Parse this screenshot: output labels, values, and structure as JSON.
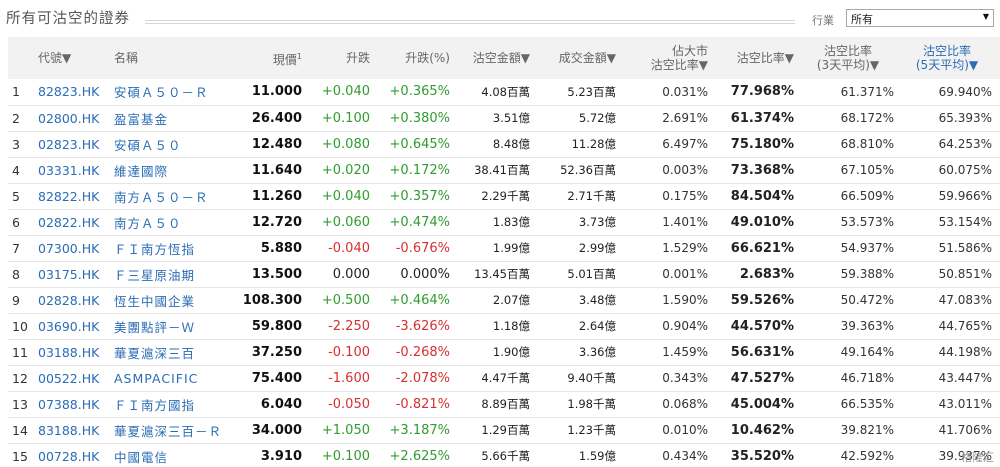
{
  "page": {
    "title": "所有可沽空的證券",
    "filter_label": "行業",
    "filter_value": "所有",
    "watermark": "格隆汇"
  },
  "table": {
    "headers": {
      "code": "代號▼",
      "name": "名稱",
      "price": "現價",
      "price_note": "1",
      "change": "升跌",
      "change_pct": "升跌(%)",
      "short_amount": "沽空金額▼",
      "turnover": "成交金額▼",
      "market_ratio_line1": "佔大市",
      "market_ratio_line2": "沽空比率▼",
      "short_ratio": "沽空比率▼",
      "avg3_line1": "沽空比率",
      "avg3_line2": "(3天平均)▼",
      "avg5_line1": "沽空比率",
      "avg5_line2": "(5天平均)▼"
    },
    "rows": [
      {
        "idx": "1",
        "code": "82823.HK",
        "name": "安碩Ａ５０－Ｒ",
        "price": "11.000",
        "change": "+0.040",
        "change_pct": "+0.365%",
        "dir": "up",
        "short_amount": "4.08百萬",
        "turnover": "5.23百萬",
        "market_ratio": "0.031%",
        "short_ratio": "77.968%",
        "avg3": "61.371%",
        "avg5": "69.940%"
      },
      {
        "idx": "2",
        "code": "02800.HK",
        "name": "盈富基金",
        "price": "26.400",
        "change": "+0.100",
        "change_pct": "+0.380%",
        "dir": "up",
        "short_amount": "3.51億",
        "turnover": "5.72億",
        "market_ratio": "2.691%",
        "short_ratio": "61.374%",
        "avg3": "68.172%",
        "avg5": "65.393%"
      },
      {
        "idx": "3",
        "code": "02823.HK",
        "name": "安碩Ａ５０",
        "price": "12.480",
        "change": "+0.080",
        "change_pct": "+0.645%",
        "dir": "up",
        "short_amount": "8.48億",
        "turnover": "11.28億",
        "market_ratio": "6.497%",
        "short_ratio": "75.180%",
        "avg3": "68.810%",
        "avg5": "64.253%"
      },
      {
        "idx": "4",
        "code": "03331.HK",
        "name": "維達國際",
        "price": "11.640",
        "change": "+0.020",
        "change_pct": "+0.172%",
        "dir": "up",
        "short_amount": "38.41百萬",
        "turnover": "52.36百萬",
        "market_ratio": "0.003%",
        "short_ratio": "73.368%",
        "avg3": "67.105%",
        "avg5": "60.075%"
      },
      {
        "idx": "5",
        "code": "82822.HK",
        "name": "南方Ａ５０－Ｒ",
        "price": "11.260",
        "change": "+0.040",
        "change_pct": "+0.357%",
        "dir": "up",
        "short_amount": "2.29千萬",
        "turnover": "2.71千萬",
        "market_ratio": "0.175%",
        "short_ratio": "84.504%",
        "avg3": "66.509%",
        "avg5": "59.966%"
      },
      {
        "idx": "6",
        "code": "02822.HK",
        "name": "南方Ａ５０",
        "price": "12.720",
        "change": "+0.060",
        "change_pct": "+0.474%",
        "dir": "up",
        "short_amount": "1.83億",
        "turnover": "3.73億",
        "market_ratio": "1.401%",
        "short_ratio": "49.010%",
        "avg3": "53.573%",
        "avg5": "53.154%"
      },
      {
        "idx": "7",
        "code": "07300.HK",
        "name": "ＦＩ南方恆指",
        "price": "5.880",
        "change": "-0.040",
        "change_pct": "-0.676%",
        "dir": "down",
        "short_amount": "1.99億",
        "turnover": "2.99億",
        "market_ratio": "1.529%",
        "short_ratio": "66.621%",
        "avg3": "54.937%",
        "avg5": "51.586%"
      },
      {
        "idx": "8",
        "code": "03175.HK",
        "name": "Ｆ三星原油期",
        "price": "13.500",
        "change": "0.000",
        "change_pct": "0.000%",
        "dir": "flat",
        "short_amount": "13.45百萬",
        "turnover": "5.01百萬",
        "market_ratio": "0.001%",
        "short_ratio": "2.683%",
        "avg3": "59.388%",
        "avg5": "50.851%"
      },
      {
        "idx": "9",
        "code": "02828.HK",
        "name": "恆生中國企業",
        "price": "108.300",
        "change": "+0.500",
        "change_pct": "+0.464%",
        "dir": "up",
        "short_amount": "2.07億",
        "turnover": "3.48億",
        "market_ratio": "1.590%",
        "short_ratio": "59.526%",
        "avg3": "50.472%",
        "avg5": "47.083%"
      },
      {
        "idx": "10",
        "code": "03690.HK",
        "name": "美團點評－Ｗ",
        "price": "59.800",
        "change": "-2.250",
        "change_pct": "-3.626%",
        "dir": "down",
        "short_amount": "1.18億",
        "turnover": "2.64億",
        "market_ratio": "0.904%",
        "short_ratio": "44.570%",
        "avg3": "39.363%",
        "avg5": "44.765%"
      },
      {
        "idx": "11",
        "code": "03188.HK",
        "name": "華夏滬深三百",
        "price": "37.250",
        "change": "-0.100",
        "change_pct": "-0.268%",
        "dir": "down",
        "short_amount": "1.90億",
        "turnover": "3.36億",
        "market_ratio": "1.459%",
        "short_ratio": "56.631%",
        "avg3": "49.164%",
        "avg5": "44.198%"
      },
      {
        "idx": "12",
        "code": "00522.HK",
        "name": "ASMPACIFIC",
        "price": "75.400",
        "change": "-1.600",
        "change_pct": "-2.078%",
        "dir": "down",
        "short_amount": "4.47千萬",
        "turnover": "9.40千萬",
        "market_ratio": "0.343%",
        "short_ratio": "47.527%",
        "avg3": "46.718%",
        "avg5": "43.447%"
      },
      {
        "idx": "13",
        "code": "07388.HK",
        "name": "ＦＩ南方國指",
        "price": "6.040",
        "change": "-0.050",
        "change_pct": "-0.821%",
        "dir": "down",
        "short_amount": "8.89百萬",
        "turnover": "1.98千萬",
        "market_ratio": "0.068%",
        "short_ratio": "45.004%",
        "avg3": "66.535%",
        "avg5": "43.011%"
      },
      {
        "idx": "14",
        "code": "83188.HK",
        "name": "華夏滬深三百－Ｒ",
        "price": "34.000",
        "change": "+1.050",
        "change_pct": "+3.187%",
        "dir": "up",
        "short_amount": "1.29百萬",
        "turnover": "1.23千萬",
        "market_ratio": "0.010%",
        "short_ratio": "10.462%",
        "avg3": "39.821%",
        "avg5": "41.706%"
      },
      {
        "idx": "15",
        "code": "00728.HK",
        "name": "中國電信",
        "price": "3.910",
        "change": "+0.100",
        "change_pct": "+2.625%",
        "dir": "up",
        "short_amount": "5.66千萬",
        "turnover": "1.59億",
        "market_ratio": "0.434%",
        "short_ratio": "35.520%",
        "avg3": "42.592%",
        "avg5": "39.937%"
      }
    ]
  },
  "colors": {
    "link": "#2a6db5",
    "up": "#2e9d2e",
    "down": "#d63030",
    "header_bg": "#f2f2f2"
  }
}
